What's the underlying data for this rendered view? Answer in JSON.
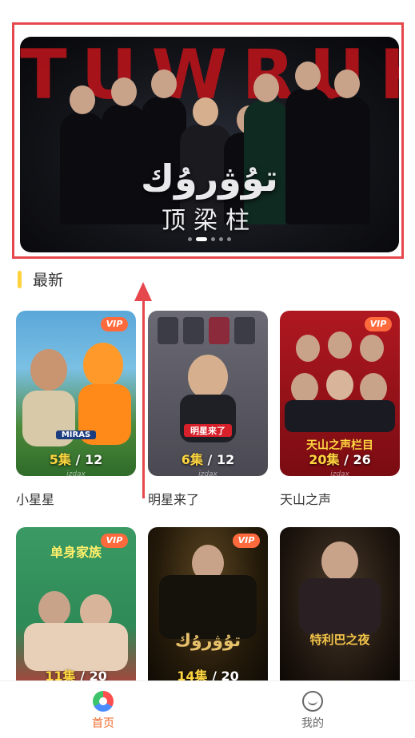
{
  "banner": {
    "big_word": "TUWRUK",
    "title_ug": "تۇۋرۇك",
    "title_cn": "顶梁柱",
    "dot_count": 5,
    "active_dot": 1
  },
  "section": {
    "title": "最新"
  },
  "cards": [
    {
      "title": "小星星",
      "vip": "VIP",
      "current_ep": "5",
      "ep_unit": "集",
      "total_ep": "12",
      "watermark": "izdax",
      "poster_text": "MIRAS"
    },
    {
      "title": "明星来了",
      "vip": "",
      "current_ep": "6",
      "ep_unit": "集",
      "total_ep": "12",
      "watermark": "izdax",
      "poster_text": "明星来了"
    },
    {
      "title": "天山之声",
      "vip": "VIP",
      "current_ep": "20",
      "ep_unit": "集",
      "total_ep": "26",
      "watermark": "izdax",
      "poster_text": "天山之声栏目"
    },
    {
      "title": "",
      "vip": "VIP",
      "current_ep": "11",
      "ep_unit": "集",
      "total_ep": "20",
      "watermark": "",
      "poster_text": "单身家族"
    },
    {
      "title": "",
      "vip": "VIP",
      "current_ep": "14",
      "ep_unit": "集",
      "total_ep": "20",
      "watermark": "",
      "poster_text": "تۇۋرۇك"
    },
    {
      "title": "",
      "vip": "",
      "current_ep": "",
      "ep_unit": "",
      "total_ep": "",
      "watermark": "",
      "poster_text": "特利巴之夜"
    }
  ],
  "tabs": [
    {
      "label": "首页",
      "active": true
    },
    {
      "label": "我的",
      "active": false
    }
  ],
  "colors": {
    "accent": "#f06a2a",
    "highlight": "#e6474c",
    "episode": "#ffd640",
    "section_bar": "#ffd23c"
  }
}
